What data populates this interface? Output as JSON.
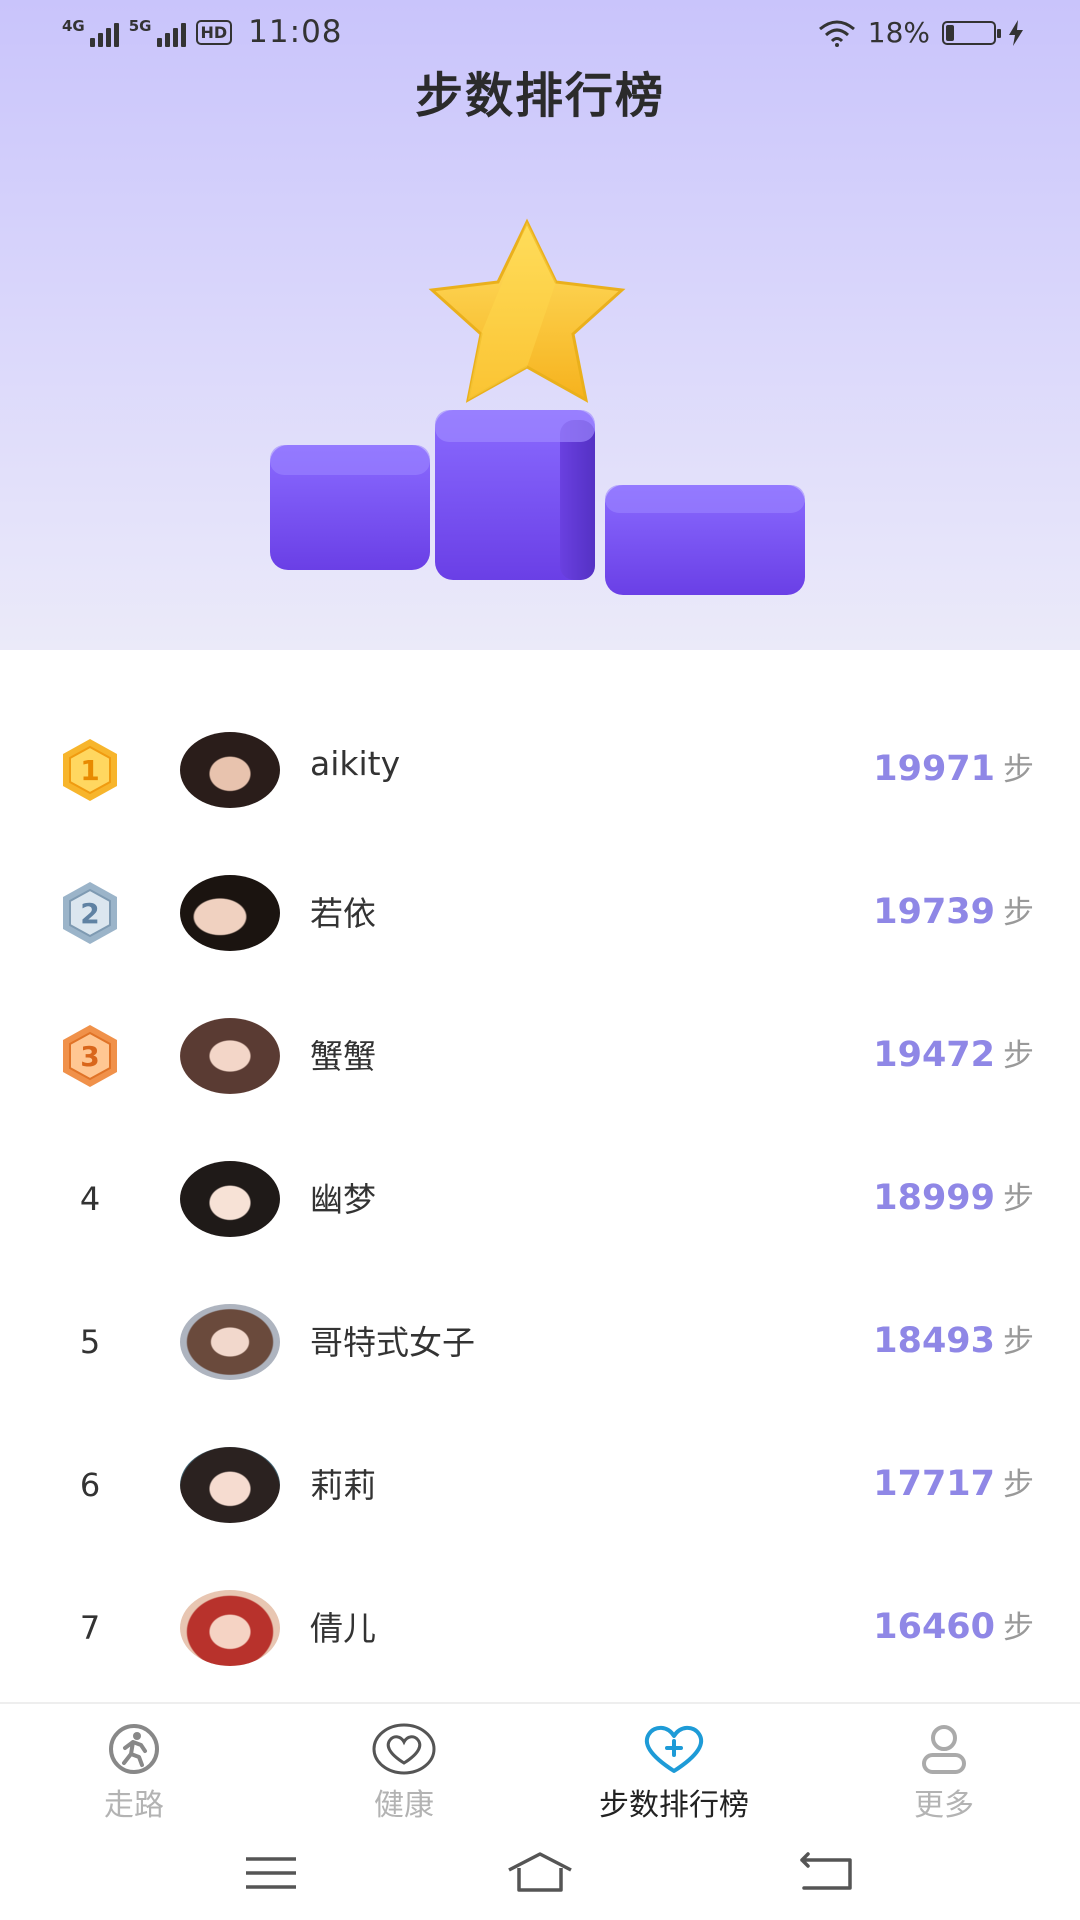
{
  "status_bar": {
    "net1": "4G",
    "net2": "5G",
    "hd": "HD",
    "time": "11:08",
    "battery": "18%",
    "battery_level": 0.18
  },
  "page_title": "步数排行榜",
  "ranking": [
    {
      "rank": "1",
      "name": "aikity",
      "steps": "19971",
      "unit": "步",
      "medal": "gold"
    },
    {
      "rank": "2",
      "name": "若依",
      "steps": "19739",
      "unit": "步",
      "medal": "silver"
    },
    {
      "rank": "3",
      "name": "蟹蟹",
      "steps": "19472",
      "unit": "步",
      "medal": "bronze"
    },
    {
      "rank": "4",
      "name": "幽梦",
      "steps": "18999",
      "unit": "步"
    },
    {
      "rank": "5",
      "name": "哥特式女子",
      "steps": "18493",
      "unit": "步"
    },
    {
      "rank": "6",
      "name": "莉莉",
      "steps": "17717",
      "unit": "步"
    },
    {
      "rank": "7",
      "name": "倩儿",
      "steps": "16460",
      "unit": "步"
    }
  ],
  "tabs": [
    {
      "label": "走路",
      "icon": "walk-icon",
      "active": false
    },
    {
      "label": "健康",
      "icon": "heart-icon",
      "active": false
    },
    {
      "label": "步数排行榜",
      "icon": "heart-plus-icon",
      "active": true
    },
    {
      "label": "更多",
      "icon": "user-icon",
      "active": false
    }
  ],
  "colors": {
    "accent": "#8f87e6",
    "tab_active_icon": "#1e9bd7",
    "podium": "#7a52f0",
    "star": "#ffcd3c",
    "gold": "#f7b52c",
    "silver": "#9bb4c9",
    "bronze": "#f0914a"
  }
}
